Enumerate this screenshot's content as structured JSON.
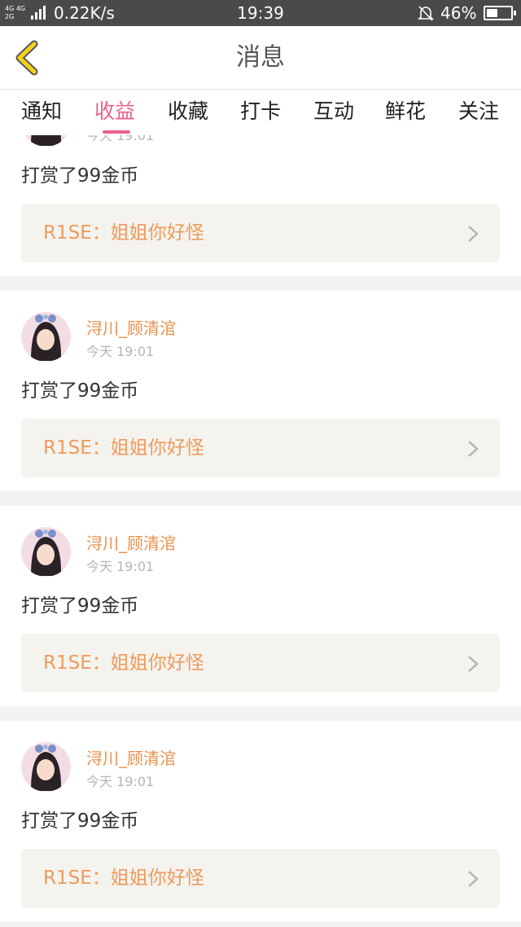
{
  "status_bar": {
    "network_top": "4G 4G",
    "network_bottom": "2G",
    "speed": "0.22K/s",
    "time": "19:39",
    "battery": "46%",
    "battery_level": 0.46,
    "icons": [
      "signal-icon",
      "bell-muted-icon",
      "battery-icon"
    ]
  },
  "navbar": {
    "title": "消息",
    "back_icon": "back-chevron-icon"
  },
  "tabs": [
    {
      "label": "通知"
    },
    {
      "label": "收益",
      "active": true
    },
    {
      "label": "收藏"
    },
    {
      "label": "打卡"
    },
    {
      "label": "互动"
    },
    {
      "label": "鲜花"
    },
    {
      "label": "关注"
    }
  ],
  "messages": [
    {
      "user": "浔川_顾清涫",
      "time": "今天 19:01",
      "action": "打赏了99金币",
      "quote": "R1SE：姐姐你好怪"
    },
    {
      "user": "浔川_顾清涫",
      "time": "今天 19:01",
      "action": "打赏了99金币",
      "quote": "R1SE：姐姐你好怪"
    },
    {
      "user": "浔川_顾清涫",
      "time": "今天 19:01",
      "action": "打赏了99金币",
      "quote": "R1SE：姐姐你好怪"
    },
    {
      "user": "浔川_顾清涫",
      "time": "今天 19:01",
      "action": "打赏了99金币",
      "quote": "R1SE：姐姐你好怪"
    }
  ],
  "colors": {
    "accent_pink": "#e8628c",
    "username_orange": "#e8914f",
    "quote_orange": "#ef9a5c",
    "quote_bg": "#f4f3ee",
    "back_yellow": "#f3d31a"
  }
}
